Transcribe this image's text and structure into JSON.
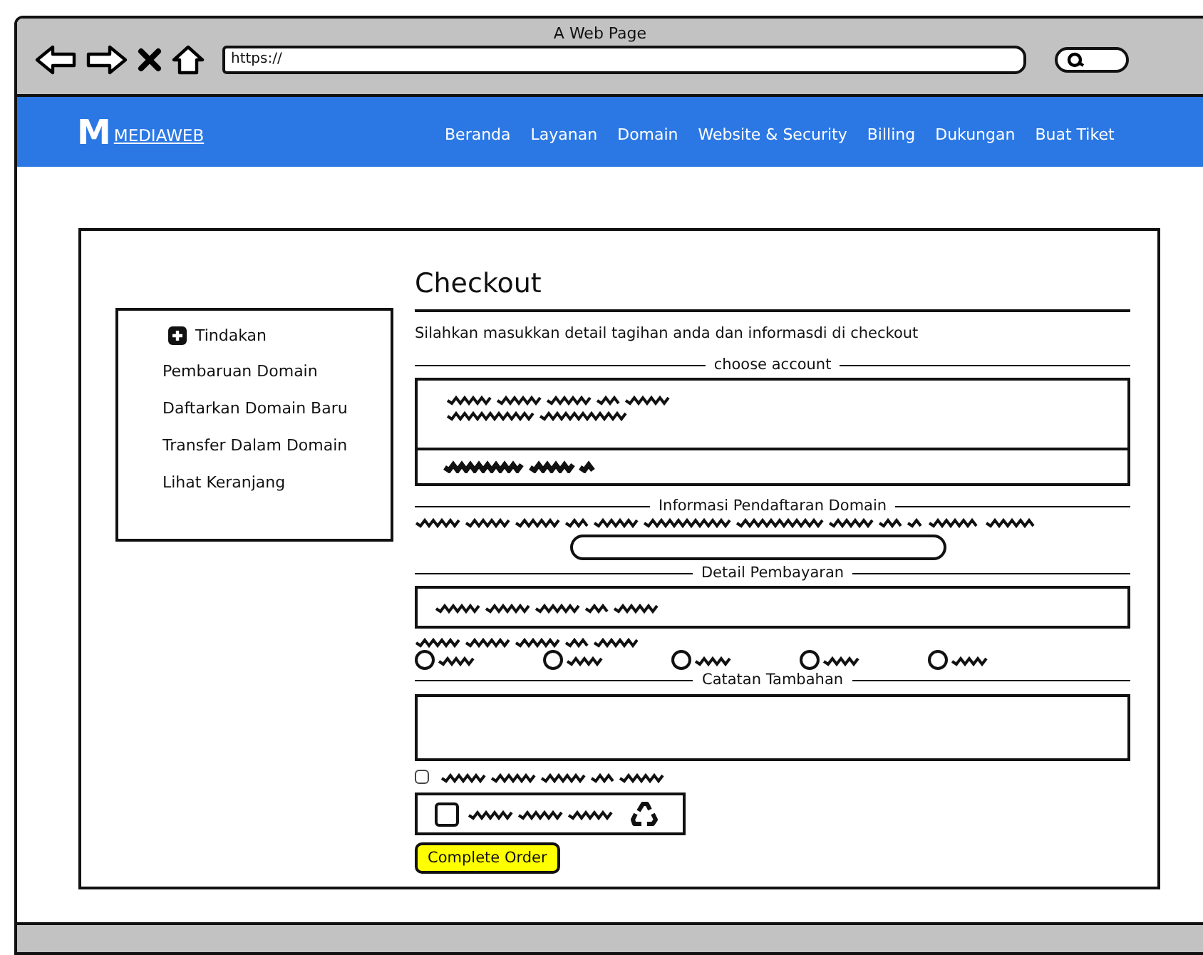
{
  "window": {
    "title": "A Web Page",
    "url": "https://"
  },
  "navbar": {
    "logo": "M",
    "brand": "MEDIAWEB",
    "items": [
      "Beranda",
      "Layanan",
      "Domain",
      "Website & Security",
      "Billing",
      "Dukungan",
      "Buat Tiket"
    ]
  },
  "sidebar": {
    "title": "Tindakan",
    "items": [
      "Pembaruan Domain",
      "Daftarkan Domain Baru",
      "Transfer Dalam Domain",
      "Lihat Keranjang"
    ]
  },
  "checkout": {
    "title": "Checkout",
    "description": "Silahkan masukkan detail tagihan anda dan informasdi di checkout",
    "sections": [
      "choose account",
      "Informasi Pendaftaran Domain",
      "Detail Pembayaran",
      "Catatan Tambahan"
    ],
    "radios": [
      {
        "selected": false
      },
      {
        "selected": false
      },
      {
        "selected": false
      },
      {
        "selected": false
      },
      {
        "selected": false
      }
    ],
    "agree": {
      "checked": false
    },
    "captcha": {
      "checked": false
    },
    "button": "Complete Order"
  }
}
